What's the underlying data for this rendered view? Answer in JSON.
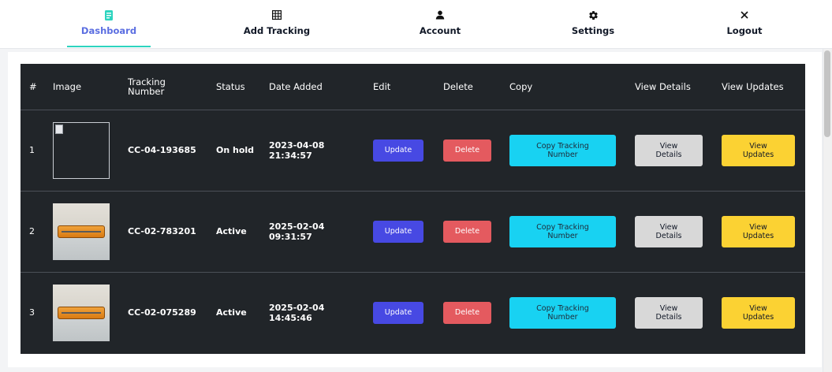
{
  "nav": {
    "items": [
      {
        "label": "Dashboard",
        "icon": "document-icon",
        "active": true
      },
      {
        "label": "Add Tracking",
        "icon": "grid-icon",
        "active": false
      },
      {
        "label": "Account",
        "icon": "person-icon",
        "active": false
      },
      {
        "label": "Settings",
        "icon": "gear-icon",
        "active": false
      },
      {
        "label": "Logout",
        "icon": "close-icon",
        "active": false
      }
    ]
  },
  "colors": {
    "accent": "#5b6ee1",
    "underline": "#2dd4bf",
    "table_bg": "#212529",
    "update": "#4749e3",
    "delete": "#e45a5f",
    "copy": "#18d2f2",
    "details": "#d8d8d8",
    "updates": "#fbd233"
  },
  "table": {
    "headers": {
      "num": "#",
      "image": "Image",
      "tracking": "Tracking Number",
      "status": "Status",
      "date": "Date Added",
      "edit": "Edit",
      "delete": "Delete",
      "copy": "Copy",
      "details": "View Details",
      "updates": "View Updates"
    },
    "rows": [
      {
        "index": "1",
        "image": "broken-image",
        "tracking": "CC-04-193685",
        "status": "On hold",
        "date": "2023-04-08",
        "time": "21:34:57"
      },
      {
        "index": "2",
        "image": "suitcase-photo",
        "tracking": "CC-02-783201",
        "status": "Active",
        "date": "2025-02-04",
        "time": "09:31:57"
      },
      {
        "index": "3",
        "image": "suitcase-photo",
        "tracking": "CC-02-075289",
        "status": "Active",
        "date": "2025-02-04",
        "time": "14:45:46"
      }
    ],
    "buttons": {
      "update": "Update",
      "delete": "Delete",
      "copy": "Copy Tracking Number",
      "details": "View Details",
      "updates": "View Updates"
    }
  }
}
